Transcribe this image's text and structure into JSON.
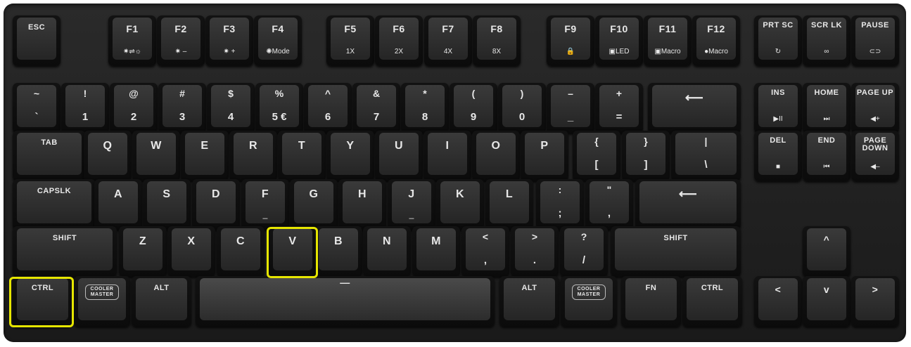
{
  "highlight_color": "#e6e600",
  "keys": {
    "esc": "ESC",
    "f1": "F1",
    "f1_sub": "✷⇌☼",
    "f2": "F2",
    "f2_sub": "✷ –",
    "f3": "F3",
    "f3_sub": "✷ +",
    "f4": "F4",
    "f4_sub": "✺Mode",
    "f5": "F5",
    "f5_sub": "1X",
    "f6": "F6",
    "f6_sub": "2X",
    "f7": "F7",
    "f7_sub": "4X",
    "f8": "F8",
    "f8_sub": "8X",
    "f9": "F9",
    "f9_sub": "🔒",
    "f10": "F10",
    "f10_sub": "▣LED",
    "f11": "F11",
    "f11_sub": "▣Macro",
    "f12": "F12",
    "f12_sub": "●Macro",
    "prtsc": "PRT SC",
    "prtsc_sub": "↻",
    "scrlk": "SCR LK",
    "scrlk_sub": "∞",
    "pause": "PAUSE",
    "pause_sub": "⊂⊃",
    "grave_top": "~",
    "grave_bot": "`",
    "n1_top": "!",
    "n1_bot": "1",
    "n2_top": "@",
    "n2_bot": "2",
    "n3_top": "#",
    "n3_bot": "3",
    "n4_top": "$",
    "n4_bot": "4",
    "n5_top": "%",
    "n5_bot": "5 €",
    "n6_top": "^",
    "n6_bot": "6",
    "n7_top": "&",
    "n7_bot": "7",
    "n8_top": "*",
    "n8_bot": "8",
    "n9_top": "(",
    "n9_bot": "9",
    "n0_top": ")",
    "n0_bot": "0",
    "minus_top": "–",
    "minus_bot": "_",
    "equal_top": "+",
    "equal_bot": "=",
    "backspace": "⟵",
    "ins": "INS",
    "ins_sub": "▶II",
    "home": "HOME",
    "home_sub": "⏭",
    "pgup": "PAGE UP",
    "pgup_sub": "◀+",
    "tab": "TAB",
    "q": "Q",
    "w": "W",
    "e": "E",
    "r": "R",
    "t": "T",
    "y": "Y",
    "u": "U",
    "i": "I",
    "o": "O",
    "p": "P",
    "lbr_top": "{",
    "lbr_bot": "[",
    "rbr_top": "}",
    "rbr_bot": "]",
    "bsl_top": "|",
    "bsl_bot": "\\",
    "del": "DEL",
    "del_sub": "■",
    "end": "END",
    "end_sub": "⏮",
    "pgdn": "PAGE DOWN",
    "pgdn_sub": "◀–",
    "caps": "CAPSLK",
    "a": "A",
    "s": "S",
    "d": "D",
    "f": "F",
    "g": "G",
    "h": "H",
    "j": "J",
    "k": "K",
    "l": "L",
    "semi_top": ":",
    "semi_bot": ";",
    "quote_top": "\"",
    "quote_bot": ",",
    "enter": "⟵",
    "lshift": "SHIFT",
    "z": "Z",
    "x": "X",
    "c": "C",
    "v": "V",
    "b": "B",
    "n": "N",
    "m": "M",
    "comma_top": "<",
    "comma_bot": ",",
    "period_top": ">",
    "period_bot": ".",
    "slash_top": "?",
    "slash_bot": "/",
    "rshift": "SHIFT",
    "up": "^",
    "lctrl": "CTRL",
    "lwin": "COOLER MASTER",
    "lalt": "ALT",
    "space": "—",
    "ralt": "ALT",
    "rwin": "COOLER MASTER",
    "fn": "FN",
    "rctrl": "CTRL",
    "left": "<",
    "down": "v",
    "right": ">"
  }
}
